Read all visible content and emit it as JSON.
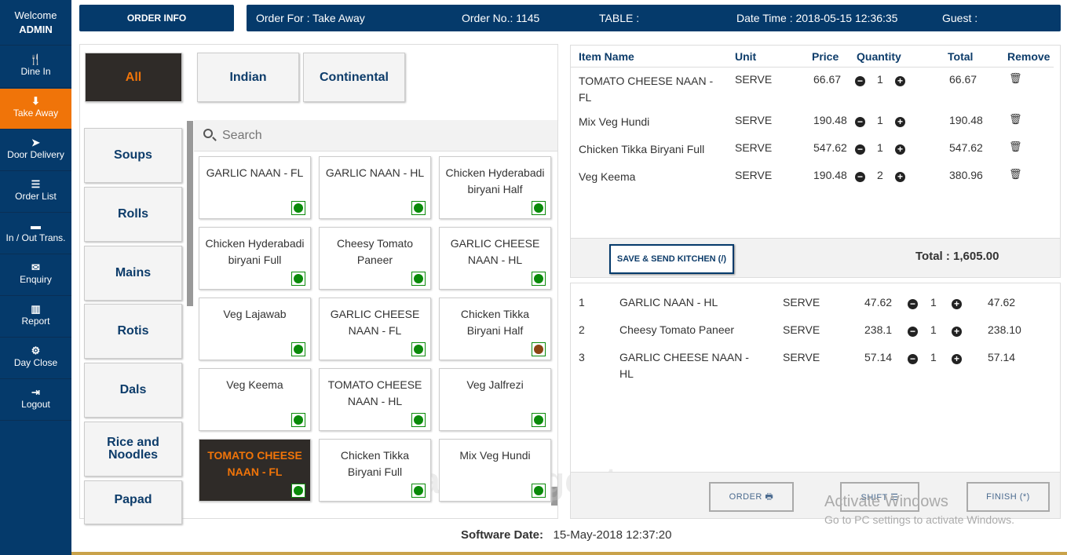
{
  "sidebar": {
    "welcome": "Welcome",
    "user": "ADMIN",
    "items": [
      {
        "label": "Dine In",
        "icon": "cutlery-icon",
        "glyph": "🍴"
      },
      {
        "label": "Take Away",
        "icon": "arrow-down-icon",
        "glyph": "⬇",
        "active": true
      },
      {
        "label": "Door Delivery",
        "icon": "paper-plane-icon",
        "glyph": "➤"
      },
      {
        "label": "Order List",
        "icon": "list-icon",
        "glyph": "☰"
      },
      {
        "label": "In / Out Trans.",
        "icon": "minus-square-icon",
        "glyph": "▬"
      },
      {
        "label": "Enquiry",
        "icon": "envelope-icon",
        "glyph": "✉"
      },
      {
        "label": "Report",
        "icon": "bar-chart-icon",
        "glyph": "▥"
      },
      {
        "label": "Day Close",
        "icon": "gear-icon",
        "glyph": "⚙"
      },
      {
        "label": "Logout",
        "icon": "sign-out-icon",
        "glyph": "⇥"
      }
    ]
  },
  "header": {
    "order_info": "ORDER INFO",
    "order_for": "Order For : Take Away",
    "order_no": "Order No.: 1145",
    "table": "TABLE :",
    "datetime": "Date Time : 2018-05-15 12:36:35",
    "guest": "Guest :"
  },
  "tabs": [
    {
      "label": "All",
      "active": true
    },
    {
      "label": "Indian"
    },
    {
      "label": "Continental"
    }
  ],
  "categories": [
    "Soups",
    "Rolls",
    "Mains",
    "Rotis",
    "Dals",
    "Rice and Noodles",
    "Papad"
  ],
  "search": {
    "placeholder": "Search"
  },
  "menu_items": [
    {
      "name": "GARLIC NAAN - FL",
      "veg": "#0a8a0a"
    },
    {
      "name": "GARLIC NAAN - HL",
      "veg": "#0a8a0a"
    },
    {
      "name": "Chicken Hyderabadi biryani Half",
      "veg": "#0a8a0a"
    },
    {
      "name": "Chicken Hyderabadi biryani Full",
      "veg": "#0a8a0a"
    },
    {
      "name": "Cheesy Tomato Paneer",
      "veg": "#0a8a0a"
    },
    {
      "name": "GARLIC CHEESE NAAN - HL",
      "veg": "#0a8a0a"
    },
    {
      "name": "Veg Lajawab",
      "veg": "#0a8a0a"
    },
    {
      "name": "GARLIC CHEESE NAAN - FL",
      "veg": "#0a8a0a"
    },
    {
      "name": "Chicken Tikka Biryani Half",
      "veg": "#8b4513"
    },
    {
      "name": "Veg Keema",
      "veg": "#0a8a0a"
    },
    {
      "name": "TOMATO CHEESE NAAN - HL",
      "veg": "#0a8a0a"
    },
    {
      "name": "Veg Jalfrezi",
      "veg": "#0a8a0a"
    },
    {
      "name": "TOMATO CHEESE NAAN - FL",
      "veg": "#0a8a0a",
      "active": true
    },
    {
      "name": "Chicken Tikka Biryani Full",
      "veg": "#0a8a0a"
    },
    {
      "name": "Mix Veg Hundi",
      "veg": "#0a8a0a"
    }
  ],
  "order": {
    "columns": [
      "Item Name",
      "Unit",
      "Price",
      "Quantity",
      "Total",
      "Remove"
    ],
    "rows": [
      {
        "name": "TOMATO CHEESE NAAN - FL",
        "unit": "SERVE",
        "price": "66.67",
        "qty": "1",
        "total": "66.67"
      },
      {
        "name": "Mix Veg Hundi",
        "unit": "SERVE",
        "price": "190.48",
        "qty": "1",
        "total": "190.48"
      },
      {
        "name": "Chicken Tikka Biryani Full",
        "unit": "SERVE",
        "price": "547.62",
        "qty": "1",
        "total": "547.62"
      },
      {
        "name": "Veg Keema",
        "unit": "SERVE",
        "price": "190.48",
        "qty": "2",
        "total": "380.96"
      }
    ],
    "save_label": "SAVE & SEND KITCHEN (/)",
    "total": "Total : 1,605.00"
  },
  "sent": {
    "rows": [
      {
        "no": "1",
        "name": "GARLIC NAAN - HL",
        "unit": "SERVE",
        "price": "47.62",
        "qty": "1",
        "total": "47.62"
      },
      {
        "no": "2",
        "name": "Cheesy Tomato Paneer",
        "unit": "SERVE",
        "price": "238.1",
        "qty": "1",
        "total": "238.10"
      },
      {
        "no": "3",
        "name": "GARLIC CHEESE NAAN - HL",
        "unit": "SERVE",
        "price": "57.14",
        "qty": "1",
        "total": "57.14"
      }
    ],
    "order_label": "ORDER 🖶",
    "shift_label": "SHIFT ☰",
    "finish_label": "FINISH (*)"
  },
  "watermark": {
    "line1": "Activate Windows",
    "line2": "Go to PC settings to activate Windows.",
    "brand": "SoftwareSuggest.com"
  },
  "footer": {
    "label": "Software Date:",
    "value": "15-May-2018 12:37:20"
  },
  "colors": {
    "primary": "#053a6b",
    "accent": "#f07409"
  }
}
